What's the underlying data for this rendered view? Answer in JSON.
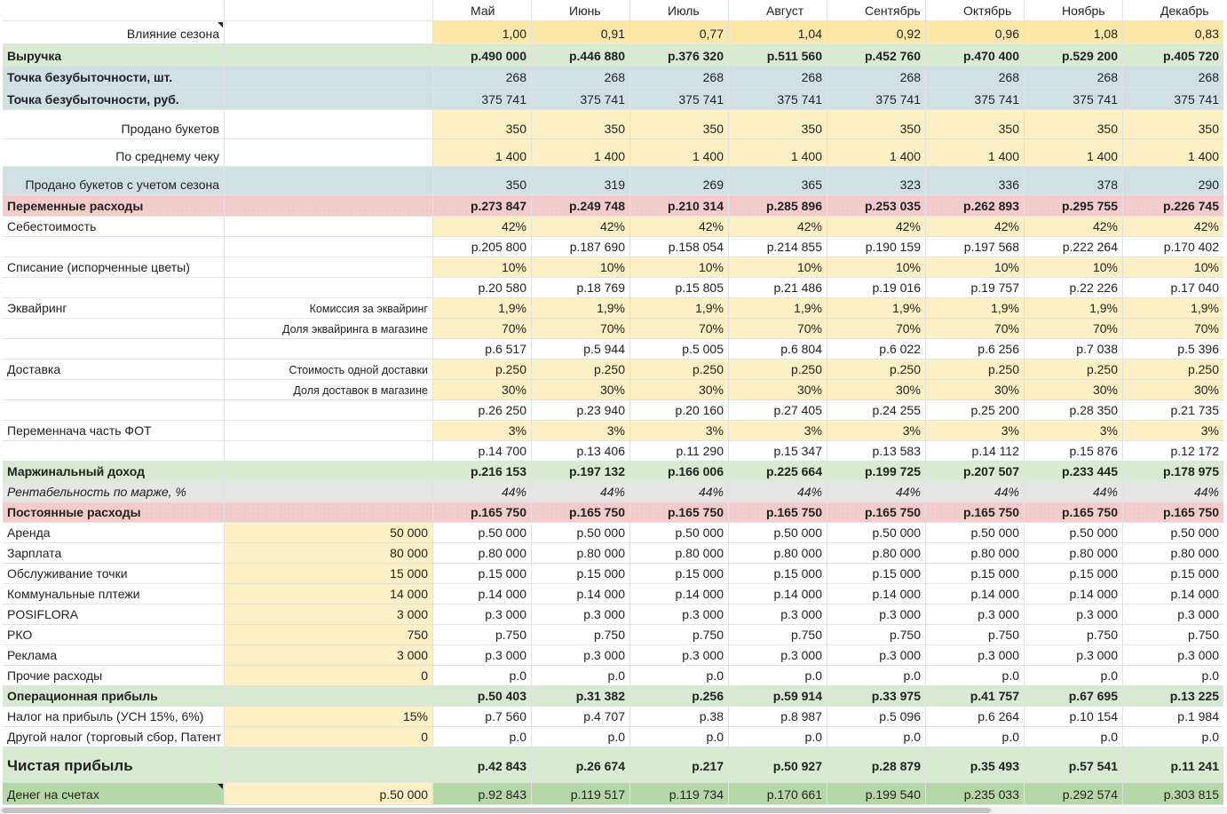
{
  "months": [
    "Май",
    "Июнь",
    "Июль",
    "Август",
    "Сентябрь",
    "Октябрь",
    "Ноябрь",
    "Декабрь"
  ],
  "rows": [
    {
      "id": "header",
      "h": 24,
      "type": "header",
      "label": "",
      "input": "",
      "values": []
    },
    {
      "id": "season",
      "h": 26,
      "label": "Влияние сезона",
      "label_align": "right",
      "input": "",
      "values": [
        "1,00",
        "0,91",
        "0,77",
        "1,04",
        "0,92",
        "0,96",
        "1,08",
        "0,83"
      ],
      "bg_label": "",
      "bg_input": "",
      "bg_values": "ydeep",
      "corner": true
    },
    {
      "id": "revenue",
      "h": 25,
      "label": "Выручка",
      "bold": true,
      "input": "",
      "values": [
        "р.490 000",
        "р.446 880",
        "р.376 320",
        "р.511 560",
        "р.452 760",
        "р.470 400",
        "р.529 200",
        "р.405 720"
      ],
      "bg_label": "g",
      "bg_input": "g",
      "bg_values": "g"
    },
    {
      "id": "bep_units",
      "h": 24,
      "label": "Точка безубыточности, шт.",
      "bold": true,
      "input": "",
      "values": [
        "268",
        "268",
        "268",
        "268",
        "268",
        "268",
        "268",
        "268"
      ],
      "bg_label": "b",
      "bg_input": "b",
      "bg_values": "b",
      "values_normal": true
    },
    {
      "id": "bep_rub",
      "h": 25,
      "label": "Точка безубыточности, руб.",
      "bold": true,
      "input": "",
      "values": [
        "375 741",
        "375 741",
        "375 741",
        "375 741",
        "375 741",
        "375 741",
        "375 741",
        "375 741"
      ],
      "bg_label": "b",
      "bg_input": "b",
      "bg_values": "b",
      "values_normal": true
    },
    {
      "id": "sold",
      "h": 33,
      "label": "Продано букетов",
      "label_align": "right",
      "input": "",
      "values": [
        "350",
        "350",
        "350",
        "350",
        "350",
        "350",
        "350",
        "350"
      ],
      "bg_label": "",
      "bg_input": "",
      "bg_values": "y"
    },
    {
      "id": "avg_check",
      "h": 31,
      "label": "По среднему чеку",
      "label_align": "right",
      "input": "",
      "values": [
        "1 400",
        "1 400",
        "1 400",
        "1 400",
        "1 400",
        "1 400",
        "1 400",
        "1 400"
      ],
      "bg_label": "",
      "bg_input": "",
      "bg_values": "y"
    },
    {
      "id": "sold_season",
      "h": 32,
      "label": "Продано букетов с учетом сезона",
      "label_align": "right",
      "input": "",
      "values": [
        "350",
        "319",
        "269",
        "365",
        "323",
        "336",
        "378",
        "290"
      ],
      "bg_label": "b",
      "bg_input": "b",
      "bg_values": "b"
    },
    {
      "id": "var_costs",
      "h": 24,
      "label": "Переменные расходы",
      "bold": true,
      "input": "",
      "values": [
        "р.273 847",
        "р.249 748",
        "р.210 314",
        "р.285 896",
        "р.253 035",
        "р.262 893",
        "р.295 755",
        "р.226 745"
      ],
      "bg_label": "r",
      "bg_input": "r",
      "bg_values": "r",
      "dotted": true
    },
    {
      "id": "cost_pct",
      "h": 23,
      "label": "Себестоимость",
      "input": "",
      "values": [
        "42%",
        "42%",
        "42%",
        "42%",
        "42%",
        "42%",
        "42%",
        "42%"
      ],
      "bg_label": "",
      "bg_input": "",
      "bg_values": "y"
    },
    {
      "id": "cost_rub",
      "h": 23,
      "label": "",
      "input": "",
      "values": [
        "р.205 800",
        "р.187 690",
        "р.158 054",
        "р.214 855",
        "р.190 159",
        "р.197 568",
        "р.222 264",
        "р.170 402"
      ],
      "bg_label": "",
      "bg_input": "",
      "bg_values": ""
    },
    {
      "id": "writeoff_pct",
      "h": 23,
      "label": "Списание (испорченные цветы)",
      "input": "",
      "values": [
        "10%",
        "10%",
        "10%",
        "10%",
        "10%",
        "10%",
        "10%",
        "10%"
      ],
      "bg_label": "",
      "bg_input": "",
      "bg_values": "y"
    },
    {
      "id": "writeoff_rub",
      "h": 23,
      "label": "",
      "input": "",
      "values": [
        "р.20 580",
        "р.18 769",
        "р.15 805",
        "р.21 486",
        "р.19 016",
        "р.19 757",
        "р.22 226",
        "р.17 040"
      ],
      "bg_label": "",
      "bg_input": "",
      "bg_values": ""
    },
    {
      "id": "acq_fee",
      "h": 23,
      "label": "Эквайринг",
      "input": "Комиссия за эквайринг",
      "input_small": true,
      "values": [
        "1,9%",
        "1,9%",
        "1,9%",
        "1,9%",
        "1,9%",
        "1,9%",
        "1,9%",
        "1,9%"
      ],
      "bg_label": "",
      "bg_input": "",
      "bg_values": "y"
    },
    {
      "id": "acq_share",
      "h": 23,
      "label": "",
      "input": "Доля эквайринга в магазине",
      "input_small": true,
      "values": [
        "70%",
        "70%",
        "70%",
        "70%",
        "70%",
        "70%",
        "70%",
        "70%"
      ],
      "bg_label": "",
      "bg_input": "",
      "bg_values": "y"
    },
    {
      "id": "acq_rub",
      "h": 23,
      "label": "",
      "input": "",
      "values": [
        "р.6 517",
        "р.5 944",
        "р.5 005",
        "р.6 804",
        "р.6 022",
        "р.6 256",
        "р.7 038",
        "р.5 396"
      ],
      "bg_label": "",
      "bg_input": "",
      "bg_values": ""
    },
    {
      "id": "delivery_cost",
      "h": 23,
      "label": "Доставка",
      "input": "Стоимость одной доставки",
      "input_small": true,
      "values": [
        "р.250",
        "р.250",
        "р.250",
        "р.250",
        "р.250",
        "р.250",
        "р.250",
        "р.250"
      ],
      "bg_label": "",
      "bg_input": "",
      "bg_values": "y"
    },
    {
      "id": "delivery_share",
      "h": 23,
      "label": "",
      "input": "Доля доставок в магазине",
      "input_small": true,
      "values": [
        "30%",
        "30%",
        "30%",
        "30%",
        "30%",
        "30%",
        "30%",
        "30%"
      ],
      "bg_label": "",
      "bg_input": "",
      "bg_values": "y"
    },
    {
      "id": "delivery_rub",
      "h": 23,
      "label": "",
      "input": "",
      "values": [
        "р.26 250",
        "р.23 940",
        "р.20 160",
        "р.27 405",
        "р.24 255",
        "р.25 200",
        "р.28 350",
        "р.21 735"
      ],
      "bg_label": "",
      "bg_input": "",
      "bg_values": ""
    },
    {
      "id": "var_payroll_pct",
      "h": 23,
      "label": "Переменнача часть ФОТ",
      "input": "",
      "values": [
        "3%",
        "3%",
        "3%",
        "3%",
        "3%",
        "3%",
        "3%",
        "3%"
      ],
      "bg_label": "",
      "bg_input": "",
      "bg_values": "y"
    },
    {
      "id": "var_payroll_rub",
      "h": 23,
      "label": "",
      "input": "",
      "values": [
        "р.14 700",
        "р.13 406",
        "р.11 290",
        "р.15 347",
        "р.13 583",
        "р.14 112",
        "р.15 876",
        "р.12 172"
      ],
      "bg_label": "",
      "bg_input": "",
      "bg_values": ""
    },
    {
      "id": "margin_income",
      "h": 23,
      "label": "Маржинальный доход",
      "bold": true,
      "input": "",
      "values": [
        "р.216 153",
        "р.197 132",
        "р.166 006",
        "р.225 664",
        "р.199 725",
        "р.207 507",
        "р.233 445",
        "р.178 975"
      ],
      "bg_label": "g",
      "bg_input": "g",
      "bg_values": "g"
    },
    {
      "id": "margin_pct",
      "h": 23,
      "label": "Рентабельность по марже, %",
      "italic": true,
      "input": "",
      "values": [
        "44%",
        "44%",
        "44%",
        "44%",
        "44%",
        "44%",
        "44%",
        "44%"
      ],
      "bg_label": "gr",
      "bg_input": "gr",
      "bg_values": "gr",
      "values_italic": true
    },
    {
      "id": "fixed_costs",
      "h": 23,
      "label": "Постоянные расходы",
      "bold": true,
      "input": "",
      "values": [
        "р.165 750",
        "р.165 750",
        "р.165 750",
        "р.165 750",
        "р.165 750",
        "р.165 750",
        "р.165 750",
        "р.165 750"
      ],
      "bg_label": "r",
      "bg_input": "r",
      "bg_values": "r",
      "dotted": true
    },
    {
      "id": "rent",
      "h": 23,
      "label": "Аренда",
      "input": "50 000",
      "values": [
        "р.50 000",
        "р.50 000",
        "р.50 000",
        "р.50 000",
        "р.50 000",
        "р.50 000",
        "р.50 000",
        "р.50 000"
      ],
      "bg_label": "",
      "bg_input": "y",
      "bg_values": ""
    },
    {
      "id": "salary",
      "h": 23,
      "label": "Зарплата",
      "input": "80 000",
      "values": [
        "р.80 000",
        "р.80 000",
        "р.80 000",
        "р.80 000",
        "р.80 000",
        "р.80 000",
        "р.80 000",
        "р.80 000"
      ],
      "bg_label": "",
      "bg_input": "y",
      "bg_values": ""
    },
    {
      "id": "service",
      "h": 23,
      "label": "Обслуживание точки",
      "input": "15 000",
      "values": [
        "р.15 000",
        "р.15 000",
        "р.15 000",
        "р.15 000",
        "р.15 000",
        "р.15 000",
        "р.15 000",
        "р.15 000"
      ],
      "bg_label": "",
      "bg_input": "y",
      "bg_values": ""
    },
    {
      "id": "utilities",
      "h": 23,
      "label": "Коммунальные плтежи",
      "input": "14 000",
      "values": [
        "р.14 000",
        "р.14 000",
        "р.14 000",
        "р.14 000",
        "р.14 000",
        "р.14 000",
        "р.14 000",
        "р.14 000"
      ],
      "bg_label": "",
      "bg_input": "y",
      "bg_values": ""
    },
    {
      "id": "posiflora",
      "h": 23,
      "label": "POSIFLORA",
      "input": "3 000",
      "values": [
        "р.3 000",
        "р.3 000",
        "р.3 000",
        "р.3 000",
        "р.3 000",
        "р.3 000",
        "р.3 000",
        "р.3 000"
      ],
      "bg_label": "",
      "bg_input": "y",
      "bg_values": ""
    },
    {
      "id": "rko",
      "h": 23,
      "label": "РКО",
      "input": "750",
      "values": [
        "р.750",
        "р.750",
        "р.750",
        "р.750",
        "р.750",
        "р.750",
        "р.750",
        "р.750"
      ],
      "bg_label": "",
      "bg_input": "y",
      "bg_values": ""
    },
    {
      "id": "ads",
      "h": 23,
      "label": "Реклама",
      "input": "3 000",
      "values": [
        "р.3 000",
        "р.3 000",
        "р.3 000",
        "р.3 000",
        "р.3 000",
        "р.3 000",
        "р.3 000",
        "р.3 000"
      ],
      "bg_label": "",
      "bg_input": "y",
      "bg_values": ""
    },
    {
      "id": "other",
      "h": 23,
      "label": "Прочие расходы",
      "input": "0",
      "values": [
        "р.0",
        "р.0",
        "р.0",
        "р.0",
        "р.0",
        "р.0",
        "р.0",
        "р.0"
      ],
      "bg_label": "",
      "bg_input": "y",
      "bg_values": ""
    },
    {
      "id": "op_profit",
      "h": 23,
      "label": "Операционная прибыль",
      "bold": true,
      "input": "",
      "values": [
        "р.50 403",
        "р.31 382",
        "р.256",
        "р.59 914",
        "р.33 975",
        "р.41 757",
        "р.67 695",
        "р.13 225"
      ],
      "bg_label": "g",
      "bg_input": "g",
      "bg_values": "g"
    },
    {
      "id": "tax",
      "h": 23,
      "label": "Налог на прибыль (УСН 15%, 6%)",
      "input": "15%",
      "values": [
        "р.7 560",
        "р.4 707",
        "р.38",
        "р.8 987",
        "р.5 096",
        "р.6 264",
        "р.10 154",
        "р.1 984"
      ],
      "bg_label": "",
      "bg_input": "y",
      "bg_values": ""
    },
    {
      "id": "other_tax",
      "h": 23,
      "label": "Другой налог (торговый сбор, Патент",
      "input": "0",
      "values": [
        "р.0",
        "р.0",
        "р.0",
        "р.0",
        "р.0",
        "р.0",
        "р.0",
        "р.0"
      ],
      "bg_label": "",
      "bg_input": "y",
      "bg_values": ""
    },
    {
      "id": "net_profit",
      "h": 40,
      "label": "Чистая прибыль",
      "big": true,
      "bold": true,
      "input": "",
      "values": [
        "р.42 843",
        "р.26 674",
        "р.217",
        "р.50 927",
        "р.28 879",
        "р.35 493",
        "р.57 541",
        "р.11 241"
      ],
      "bg_label": "g",
      "bg_input": "g",
      "bg_values": "g"
    },
    {
      "id": "cash",
      "h": 25,
      "label": "Денег на счетах",
      "input": "р.50 000",
      "values": [
        "р.92 843",
        "р.119 517",
        "р.119 734",
        "р.170 661",
        "р.199 540",
        "р.235 033",
        "р.292 574",
        "р.303 815"
      ],
      "bg_label": "gb",
      "bg_input": "y",
      "bg_values": "gb",
      "corner": true,
      "values_normal": true
    }
  ]
}
